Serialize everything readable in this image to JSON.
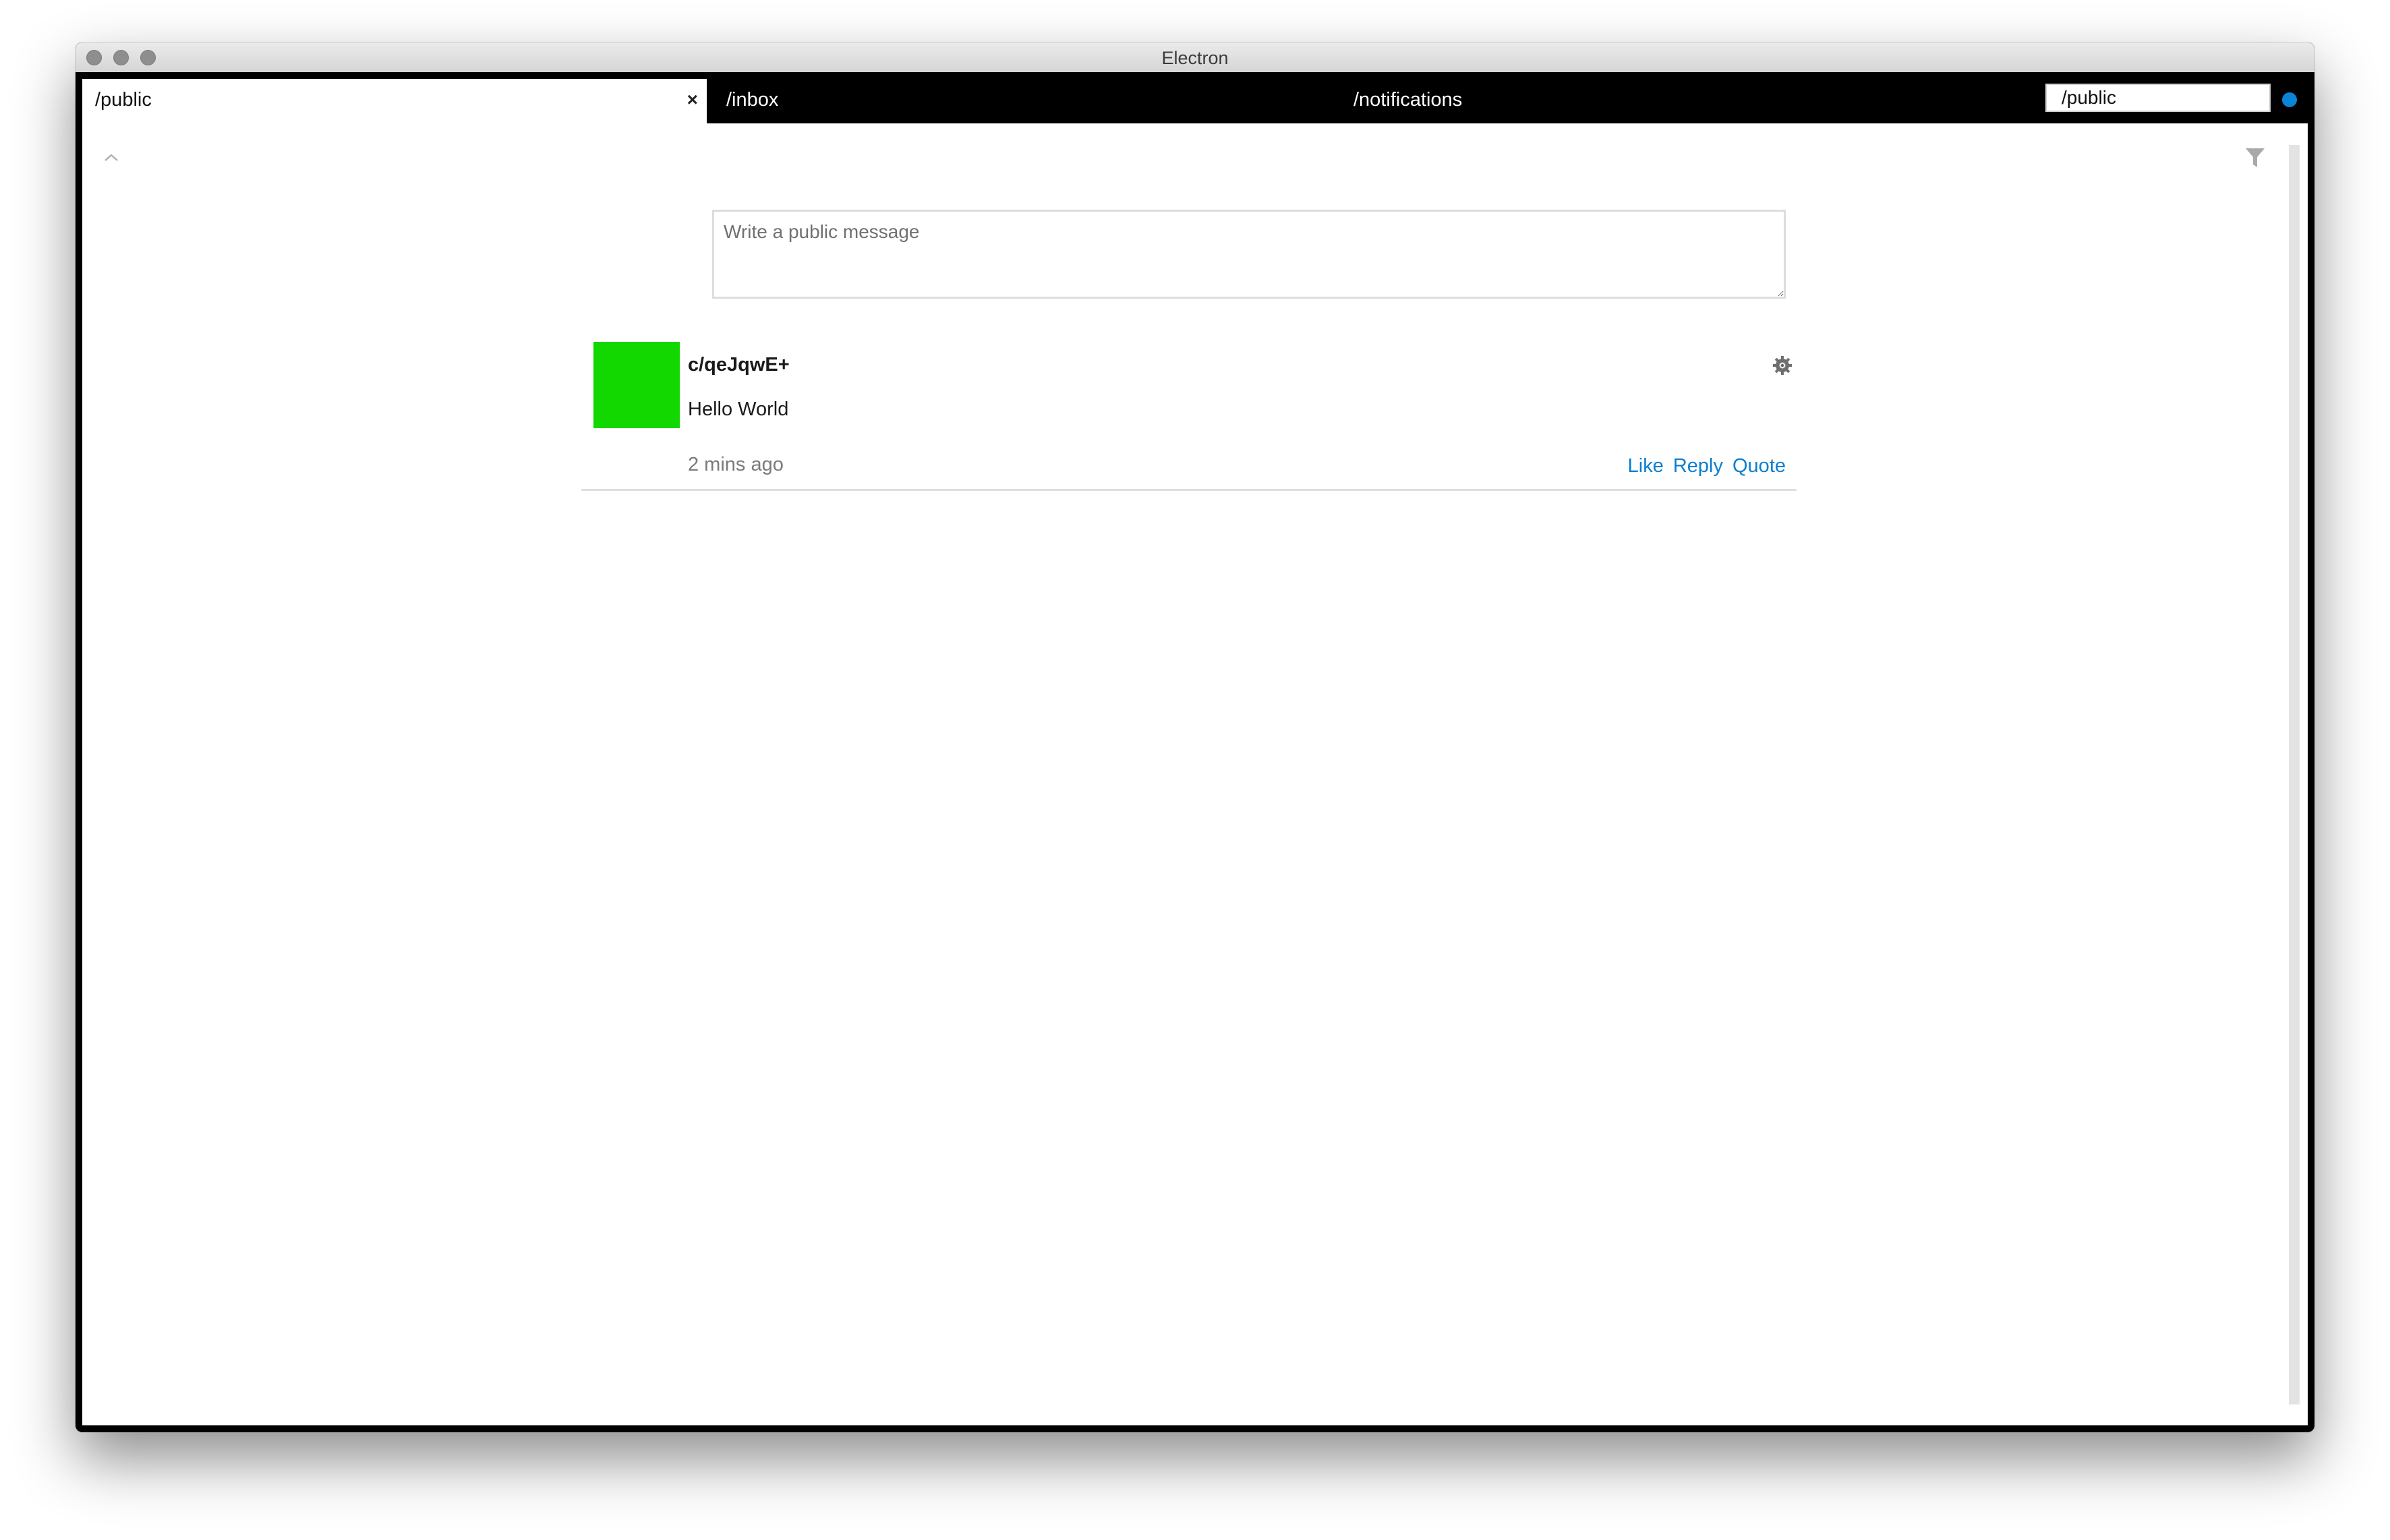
{
  "window": {
    "title": "Electron"
  },
  "tabs": {
    "active": {
      "label": "/public",
      "close_icon": "×"
    },
    "items": [
      {
        "label": "/inbox"
      },
      {
        "label": "/notifications"
      }
    ],
    "search_value": "/public",
    "status_dot_color": "#0a84d6"
  },
  "content": {
    "composer_placeholder": "Write a public message",
    "posts": [
      {
        "author": "c/qeJqwE+",
        "avatar_color": "#13d800",
        "text": "Hello World",
        "timestamp": "2 mins ago",
        "actions": [
          "Like",
          "Reply",
          "Quote"
        ]
      }
    ]
  },
  "colors": {
    "link": "#0a7fcf",
    "tabbar": "#000000"
  }
}
